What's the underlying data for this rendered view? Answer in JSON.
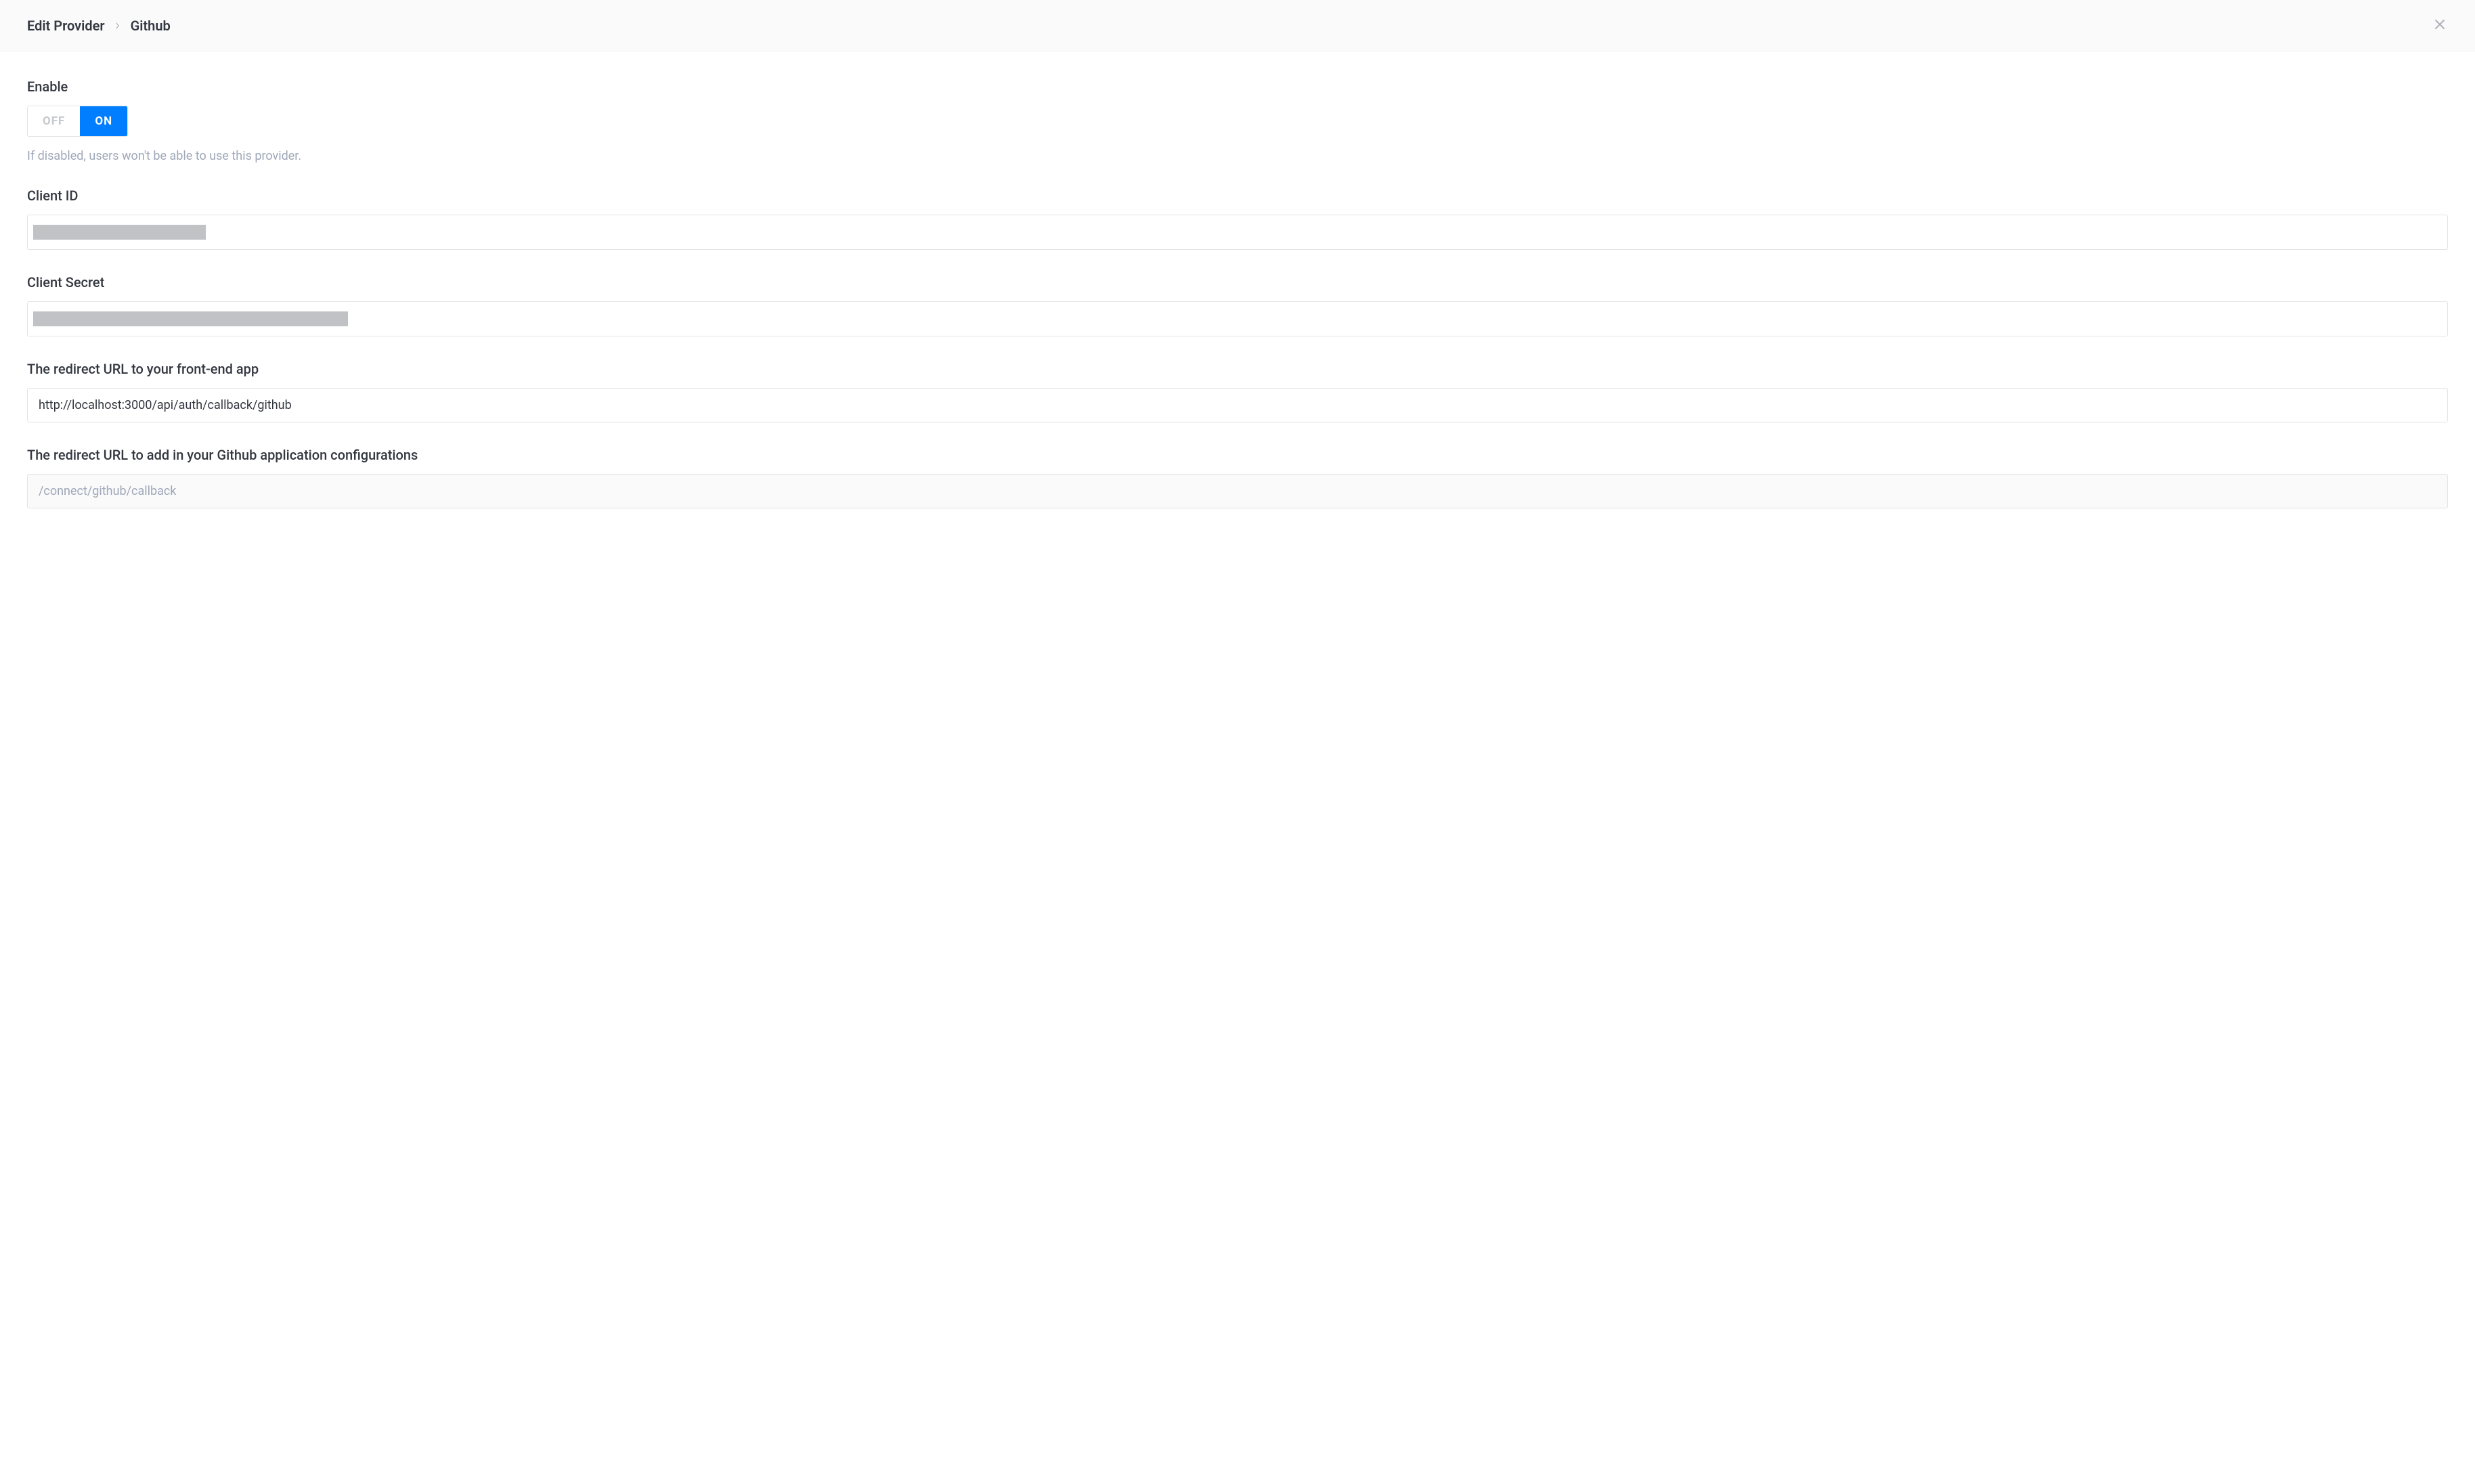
{
  "header": {
    "breadcrumb_root": "Edit Provider",
    "breadcrumb_current": "Github"
  },
  "form": {
    "enable": {
      "label": "Enable",
      "off_label": "OFF",
      "on_label": "ON",
      "help_text": "If disabled, users won't be able to use this provider."
    },
    "client_id": {
      "label": "Client ID",
      "value": ""
    },
    "client_secret": {
      "label": "Client Secret",
      "value": ""
    },
    "redirect_frontend": {
      "label": "The redirect URL to your front-end app",
      "value": "http://localhost:3000/api/auth/callback/github"
    },
    "redirect_github": {
      "label": "The redirect URL to add in your Github application configurations",
      "value": "/connect/github/callback"
    }
  }
}
